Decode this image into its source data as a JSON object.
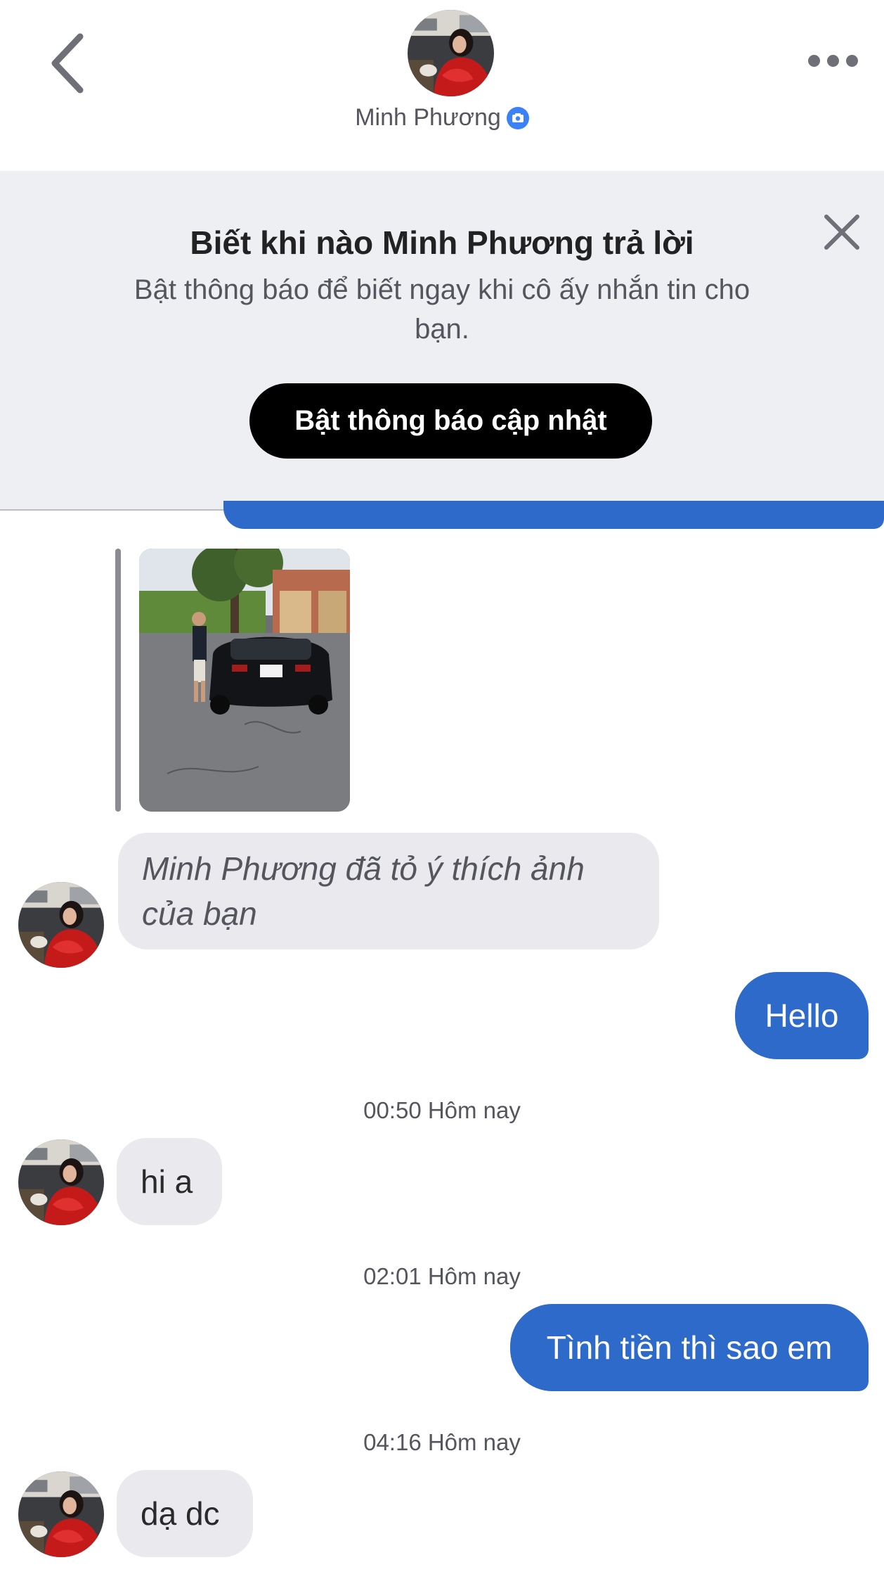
{
  "header": {
    "contact_name": "Minh Phương",
    "icons": {
      "back": "chevron-left-icon",
      "more": "more-dots-icon",
      "verified": "camera-badge-icon"
    }
  },
  "banner": {
    "title": "Biết khi nào Minh Phương trả lời",
    "subtitle": "Bật thông báo để biết ngay khi cô ấy nhắn tin cho bạn.",
    "button_label": "Bật thông báo cập nhật",
    "close_icon": "close-icon"
  },
  "messages": {
    "like_note": "Minh Phương đã tỏ ý thích ảnh của bạn",
    "out_1": "Hello",
    "ts_1": "00:50 Hôm nay",
    "in_1": "hi a",
    "ts_2": "02:01 Hôm nay",
    "out_2": "Tình tiền thì sao em",
    "ts_3": "04:16 Hôm nay",
    "in_2": "dạ dc"
  },
  "colors": {
    "accent_blue": "#2d6ac9",
    "incoming_bubble": "#eaeaee",
    "banner_bg": "#eeeff3"
  }
}
